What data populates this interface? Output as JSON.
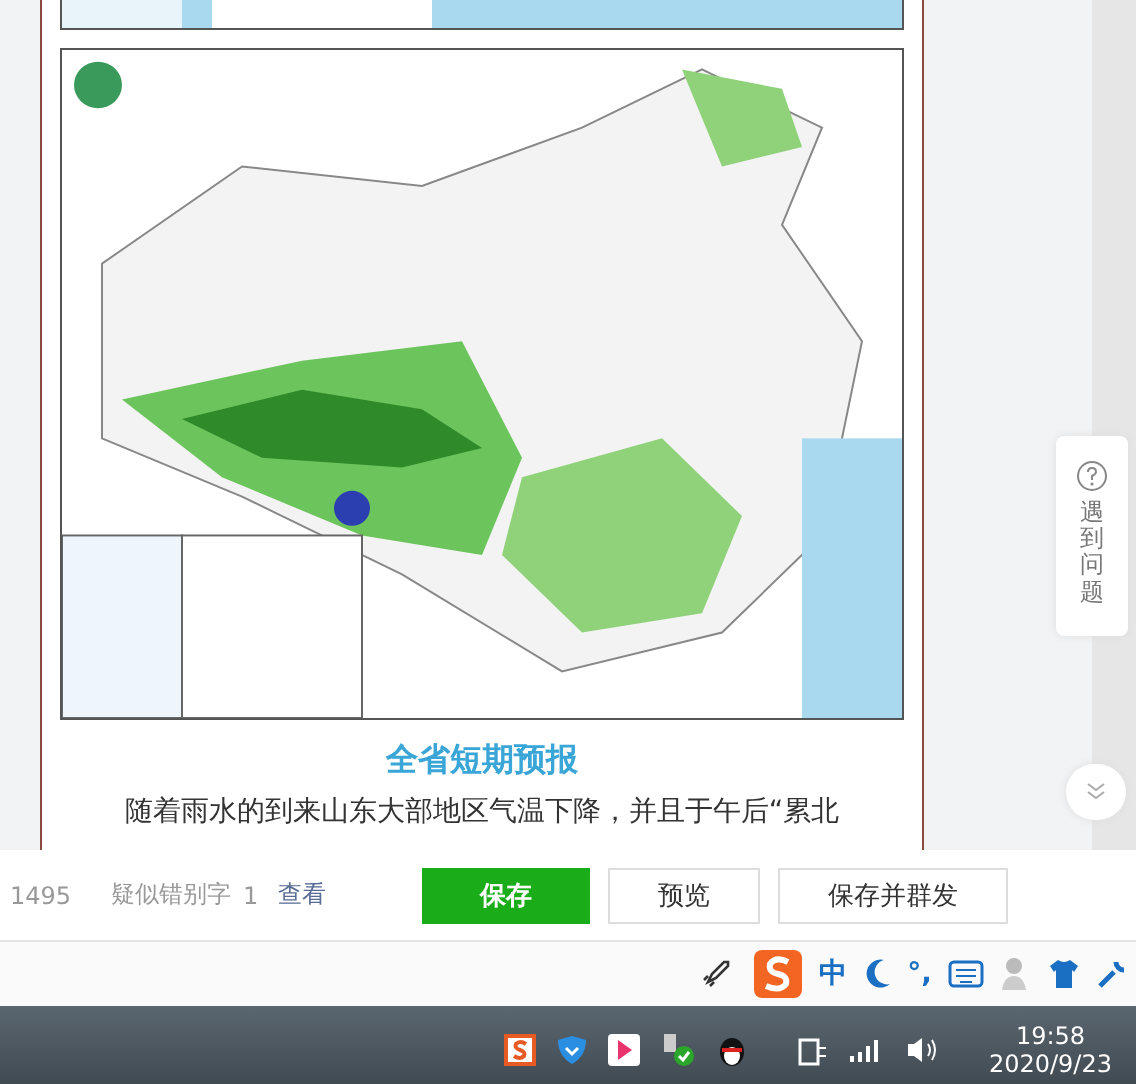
{
  "article": {
    "heading": "全省短期预报",
    "paragraph": "随着雨水的到来山东大部地区气温下降，并且于午后“累北"
  },
  "help": {
    "label": "遇到问题"
  },
  "editor_bar": {
    "word_count": "1495",
    "typo_label": "疑似错别字",
    "typo_count": "1",
    "view_link": "查看",
    "buttons": [
      {
        "label": "保存",
        "kind": "primary"
      },
      {
        "label": "预览",
        "kind": "plain"
      },
      {
        "label": "保存并群发",
        "kind": "plain"
      }
    ]
  },
  "ime_bar": {
    "mode": "中",
    "punct": "°,"
  },
  "taskbar": {
    "time": "19:58",
    "date": "2020/9/23"
  }
}
